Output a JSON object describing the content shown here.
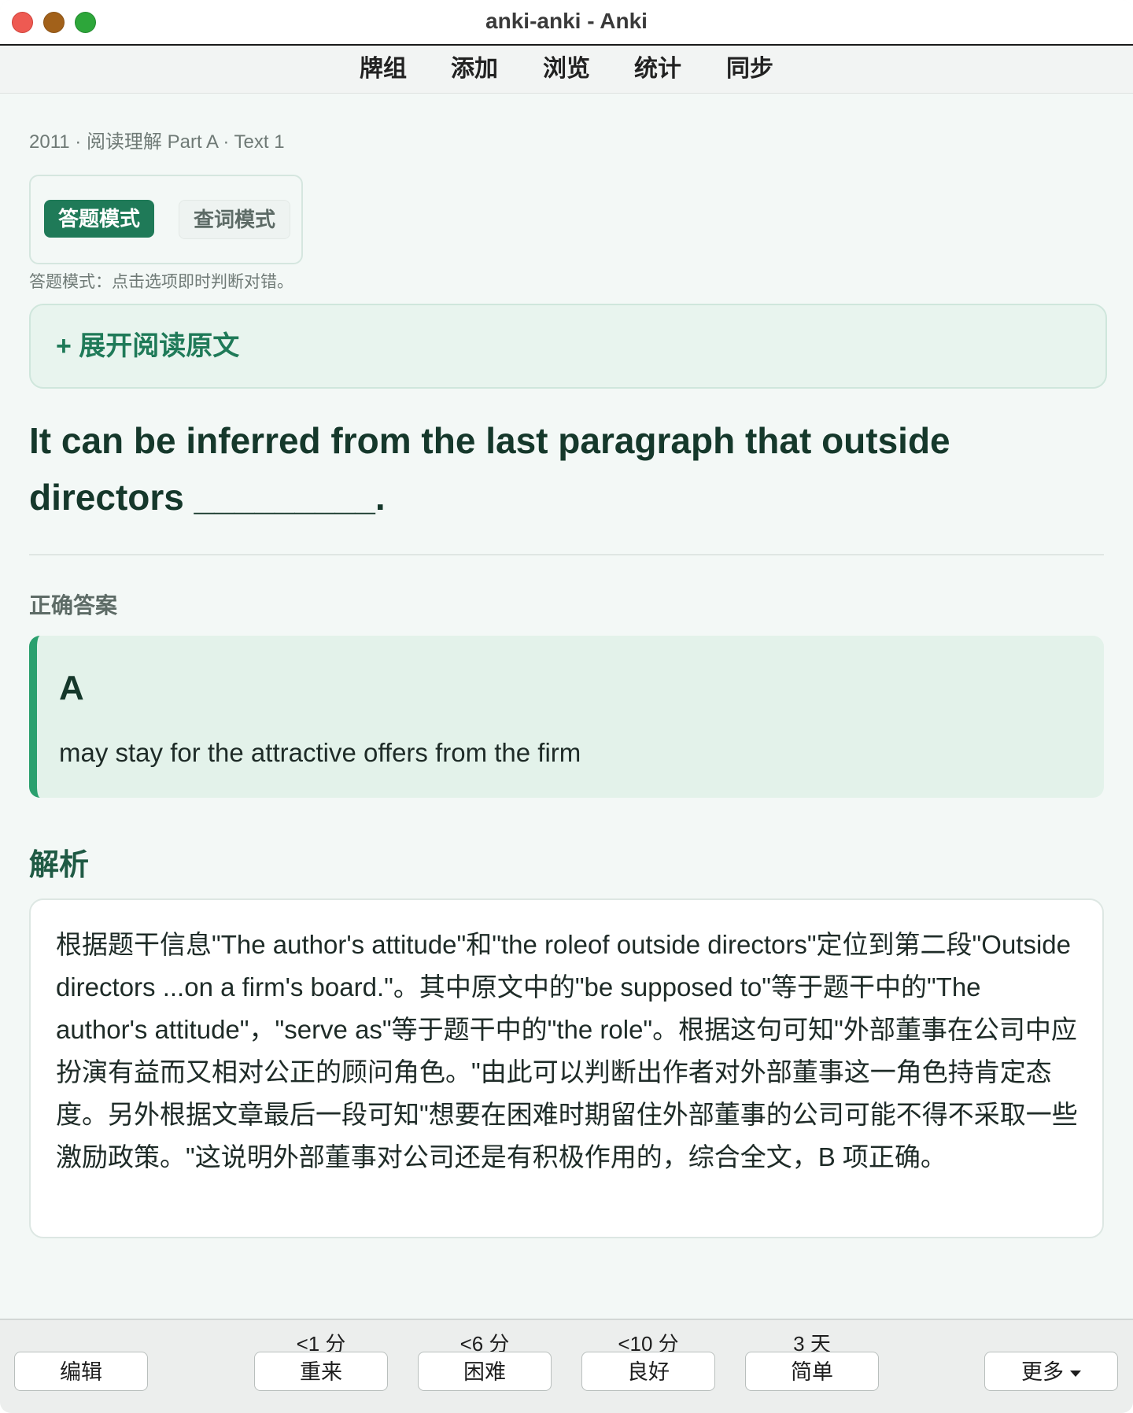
{
  "window": {
    "title": "anki-anki - Anki"
  },
  "menu": {
    "items": [
      "牌组",
      "添加",
      "浏览",
      "统计",
      "同步"
    ]
  },
  "card": {
    "breadcrumb": "2011 · 阅读理解 Part A · Text 1",
    "modes": {
      "answer_mode": "答题模式",
      "lookup_mode": "查词模式",
      "hint": "答题模式：点击选项即时判断对错。"
    },
    "expand_label": "+ 展开阅读原文",
    "question": "It can be inferred from the last paragraph that outside directors _________.",
    "correct_answer_label": "正确答案",
    "answer": {
      "letter": "A",
      "text": "may stay for the attractive offers from the firm"
    },
    "analysis_title": "解析",
    "analysis_text": "根据题干信息\"The author's attitude\"和\"the roleof outside directors\"定位到第二段\"Outside directors ...on a firm's board.\"。其中原文中的\"be supposed to\"等于题干中的\"The author's attitude\"，\"serve as\"等于题干中的\"the role\"。根据这句可知\"外部董事在公司中应扮演有益而又相对公正的顾问角色。\"由此可以判断出作者对外部董事这一角色持肯定态度。另外根据文章最后一段可知\"想要在困难时期留住外部董事的公司可能不得不采取一些激励政策。\"这说明外部董事对公司还是有积极作用的，综合全文，B 项正确。"
  },
  "review_bar": {
    "edit_label": "编辑",
    "again": {
      "interval": "<1 分",
      "label": "重来"
    },
    "hard": {
      "interval": "<6 分",
      "label": "困难"
    },
    "good": {
      "interval": "<10 分",
      "label": "良好"
    },
    "easy": {
      "interval": "3 天",
      "label": "简单"
    },
    "more_label": "更多"
  }
}
